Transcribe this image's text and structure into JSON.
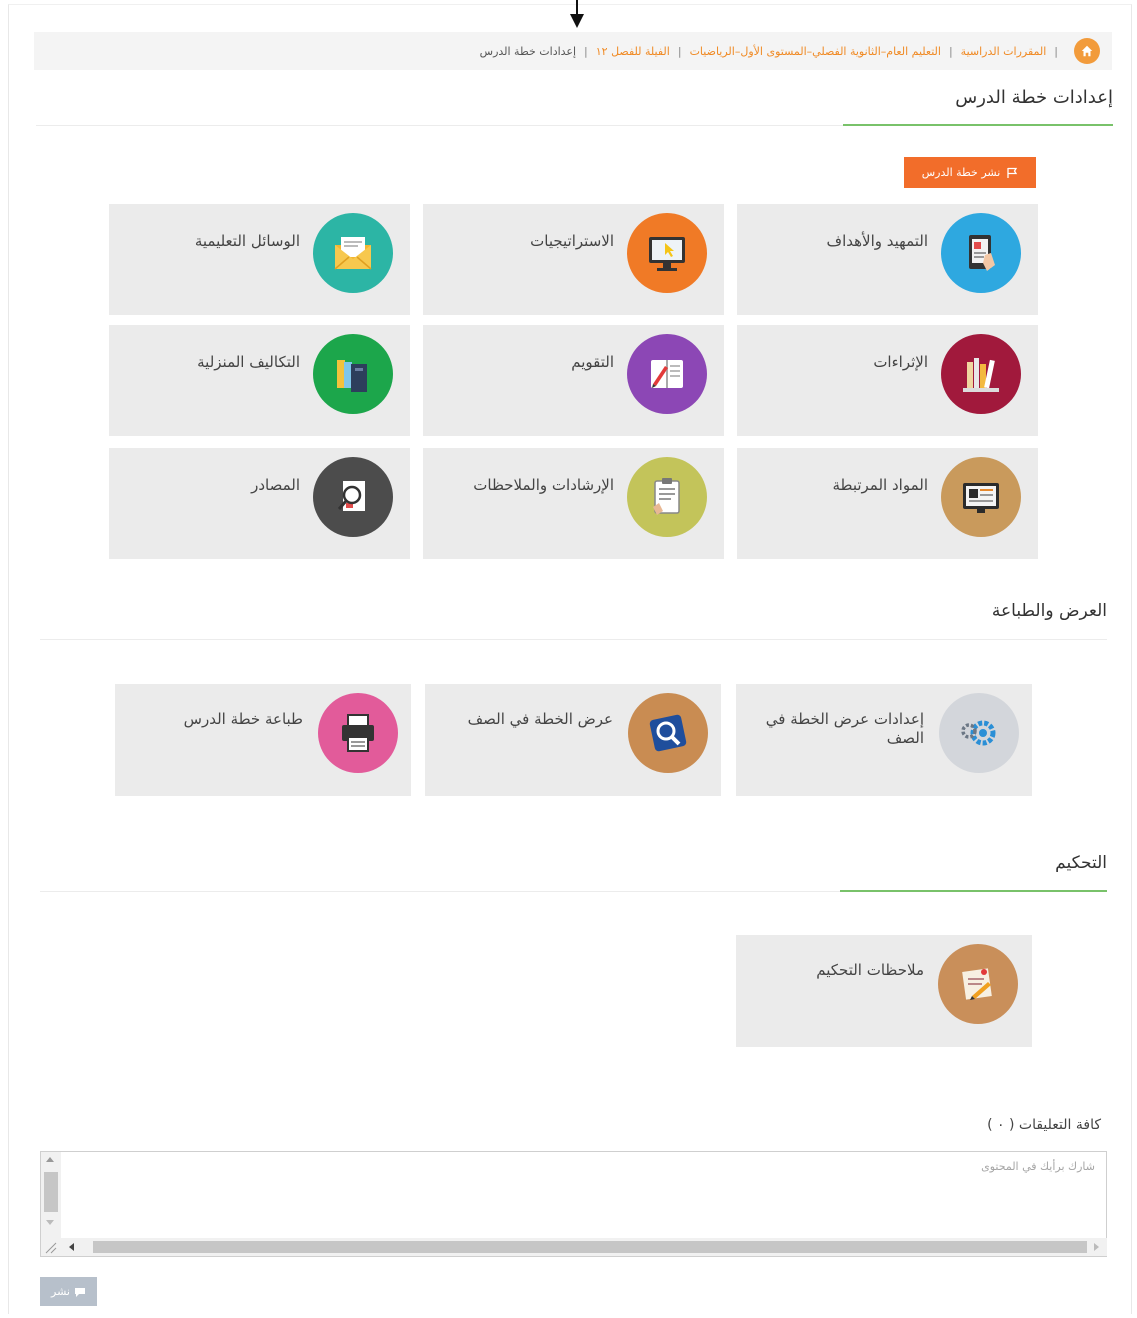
{
  "breadcrumb": {
    "items": [
      "المقررات الدراسية",
      "التعليم العام–الثانوية الفصلي–المستوى الأول–الرياضيات",
      "الفيلة للفصل ١٢"
    ],
    "current": "إعدادات خطة الدرس"
  },
  "page_title": "إعدادات خطة الدرس",
  "publish_plan_label": "نشر خطة الدرس",
  "plan_tiles": [
    {
      "label": "التمهيد والأهداف",
      "icon": "tablet-touch-icon",
      "color": "#2ea8e0"
    },
    {
      "label": "الاستراتيجيات",
      "icon": "monitor-pointer-icon",
      "color": "#f07a26"
    },
    {
      "label": "الوسائل التعليمية",
      "icon": "envelope-icon",
      "color": "#2cb5a5"
    },
    {
      "label": "الإثراءات",
      "icon": "books-icon",
      "color": "#a1193c"
    },
    {
      "label": "التقويم",
      "icon": "notebook-pencil-icon",
      "color": "#8c47b5"
    },
    {
      "label": "التكاليف المنزلية",
      "icon": "folders-icon",
      "color": "#1ca64b"
    },
    {
      "label": "المواد المرتبطة",
      "icon": "screen-content-icon",
      "color": "#c99a5c"
    },
    {
      "label": "الإرشادات والملاحظات",
      "icon": "clipboard-icon",
      "color": "#c3c45a"
    },
    {
      "label": "المصادر",
      "icon": "document-magnifier-icon",
      "color": "#4c4c4c"
    }
  ],
  "display_section": {
    "title": "العرض والطباعة",
    "tiles": [
      {
        "label": "إعدادات عرض الخطة في الصف",
        "icon": "gears-icon",
        "color": "#d3d6db"
      },
      {
        "label": "عرض الخطة في الصف",
        "icon": "magnifier-icon",
        "color": "#c98c52"
      },
      {
        "label": "طباعة خطة الدرس",
        "icon": "printer-icon",
        "color": "#e25b9a"
      }
    ]
  },
  "control_section": {
    "title": "التحكيم",
    "tiles": [
      {
        "label": "ملاحظات التحكيم",
        "icon": "notes-pen-icon",
        "color": "#c98f5a"
      }
    ]
  },
  "comments": {
    "title": "كافة التعليقات ( ٠ )",
    "placeholder": "شارك برأيك في المحتوى",
    "share_label": "نشر"
  }
}
